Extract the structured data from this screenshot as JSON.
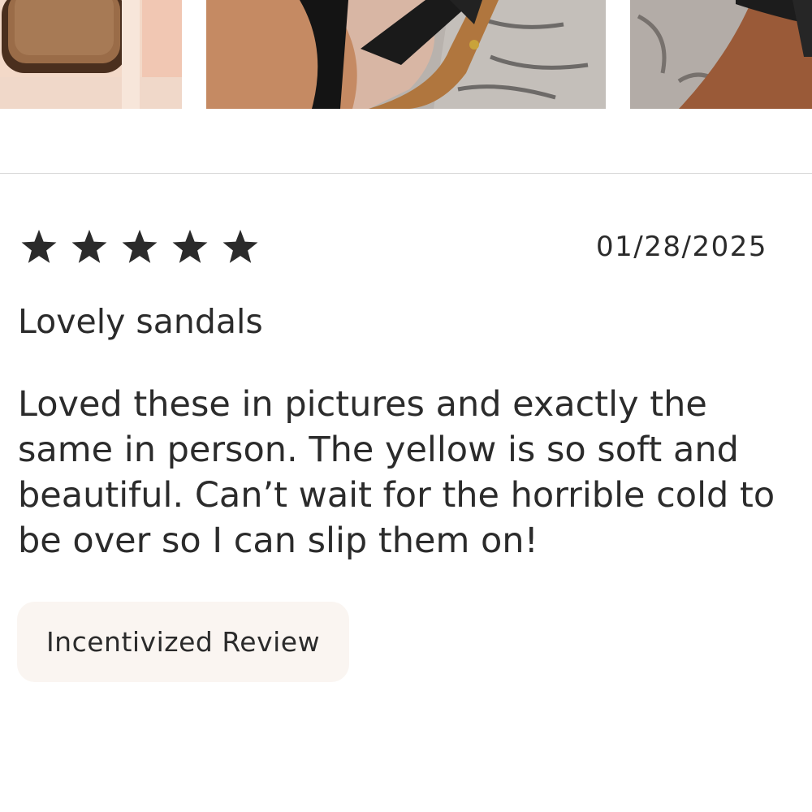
{
  "review": {
    "rating": 5,
    "rating_max": 5,
    "date": "01/28/2025",
    "title": "Lovely sandals",
    "body": "Loved these in pictures and exactly the same in person. The yellow is so soft and beautiful. Can’t wait for the horrible cold to be over so I can slip them on!",
    "badge": "Incentivized Review"
  },
  "colors": {
    "text": "#2b2b2b",
    "star": "#2b2b2b",
    "badge_background": "#faf5f1",
    "divider": "#d9d9d9"
  },
  "icons": {
    "star": "star-filled-icon"
  }
}
